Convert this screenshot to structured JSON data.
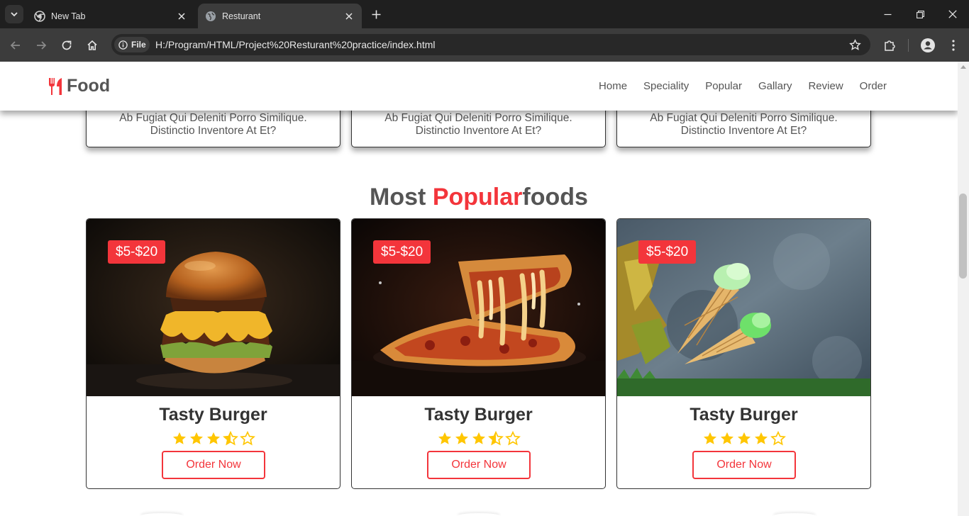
{
  "browser": {
    "tabs": [
      {
        "title": "New Tab",
        "icon": "chrome-icon",
        "active": false
      },
      {
        "title": "Resturant",
        "icon": "globe-icon",
        "active": true
      }
    ],
    "site_chip": "File",
    "url": "H:/Program/HTML/Project%20Resturant%20practice/index.html"
  },
  "site": {
    "logo_text": "Food",
    "logo_icon": "utensils-icon",
    "nav": [
      "Home",
      "Speciality",
      "Popular",
      "Gallary",
      "Review",
      "Order"
    ],
    "speciality_cards": [
      {
        "line1": "Ab Fugiat Qui Deleniti Porro Similique.",
        "line2": "Distinctio Inventore At Et?"
      },
      {
        "line1": "Ab Fugiat Qui Deleniti Porro Similique.",
        "line2": "Distinctio Inventore At Et?"
      },
      {
        "line1": "Ab Fugiat Qui Deleniti Porro Similique.",
        "line2": "Distinctio Inventore At Et?"
      }
    ],
    "section_title": {
      "prefix": "Most ",
      "accent": "Popular",
      "suffix": "foods"
    },
    "accent_color": "#f3353b",
    "star_color": "#ffc600",
    "popular": [
      {
        "price": "$5-$20",
        "name": "Tasty Burger",
        "rating": 3.5,
        "image": "burger",
        "button": "Order Now"
      },
      {
        "price": "$5-$20",
        "name": "Tasty Burger",
        "rating": 3.5,
        "image": "pizza",
        "button": "Order Now"
      },
      {
        "price": "$5-$20",
        "name": "Tasty Burger",
        "rating": 4,
        "image": "ice-cream",
        "button": "Order Now"
      }
    ]
  }
}
